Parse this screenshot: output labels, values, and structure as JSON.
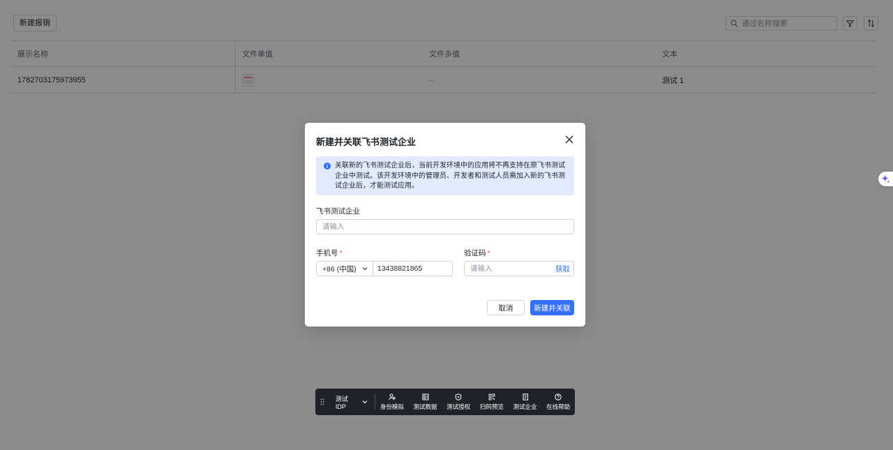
{
  "toolbar": {
    "new_expense_label": "新建报销",
    "search_placeholder": "通过名称搜索"
  },
  "table": {
    "headers": [
      "展示名称",
      "文件单值",
      "文件多值",
      "文本"
    ],
    "rows": [
      {
        "name": "1782703175973955",
        "multi_file": "--",
        "text": "测试 1"
      }
    ]
  },
  "modal": {
    "title": "新建并关联飞书测试企业",
    "notice": "关联新的飞书测试企业后，当前开发环境中的应用将不再支持在原飞书测试企业中测试。该开发环境中的管理员、开发者和测试人员需加入新的飞书测试企业后，才能测试应用。",
    "company_label": "飞书测试企业",
    "company_placeholder": "请输入",
    "phone_label": "手机号",
    "country_code": "+86 (中国)",
    "phone_value": "13438821865",
    "code_label": "验证码",
    "code_placeholder": "请输入",
    "get_code_label": "获取",
    "required_mark": "*",
    "cancel_label": "取消",
    "confirm_label": "新建并关联"
  },
  "devbar": {
    "idp_label": "测试 IDP",
    "tools": [
      "身份模拟",
      "测试数据",
      "测试授权",
      "扫码预览",
      "测试企业",
      "在线帮助"
    ]
  },
  "colors": {
    "primary": "#3370ff",
    "notice_bg": "#e1eaff",
    "required": "#f54a45",
    "devbar_bg": "#1f2329"
  }
}
